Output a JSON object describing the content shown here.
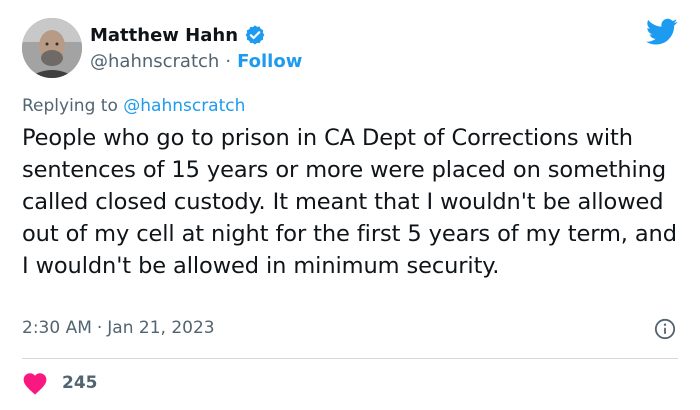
{
  "author": {
    "name": "Matthew Hahn",
    "handle": "@hahnscratch",
    "separator": "·",
    "follow_label": "Follow",
    "verified_color": "#1d9bf0"
  },
  "reply": {
    "prefix": "Replying to ",
    "handle": "@hahnscratch"
  },
  "tweet": {
    "text": "People who go to prison in CA Dept of Corrections with sentences of 15 years or more were placed on something called closed custody. It meant that I wouldn't be allowed out of my cell at night for the first 5 years of my term, and I wouldn't be allowed in minimum security."
  },
  "meta": {
    "time": "2:30 AM",
    "separator": "·",
    "date": "Jan 21, 2023"
  },
  "engagement": {
    "likes": "245",
    "heart_color": "#f91880"
  },
  "icons": {
    "brand": "twitter-bird-icon",
    "info": "info-icon",
    "like": "heart-icon"
  }
}
